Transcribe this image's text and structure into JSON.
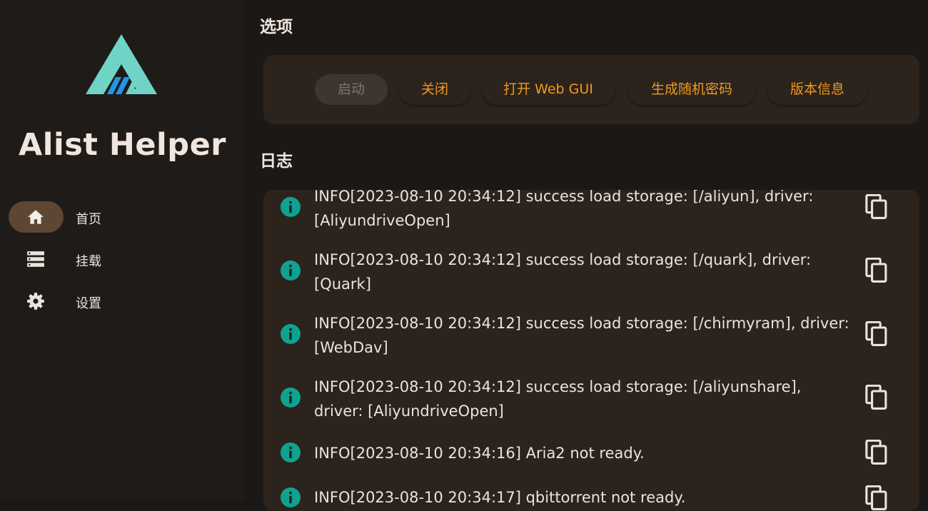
{
  "app": {
    "title": "Alist Helper"
  },
  "sidebar": {
    "items": [
      {
        "label": "首页",
        "icon": "home-icon",
        "active": true
      },
      {
        "label": "挂载",
        "icon": "storage-icon",
        "active": false
      },
      {
        "label": "设置",
        "icon": "gear-icon",
        "active": false
      }
    ]
  },
  "options": {
    "title": "选项",
    "buttons": [
      {
        "label": "启动",
        "enabled": false
      },
      {
        "label": "关闭",
        "enabled": true
      },
      {
        "label": "打开 Web GUI",
        "enabled": true
      },
      {
        "label": "生成随机密码",
        "enabled": true
      },
      {
        "label": "版本信息",
        "enabled": true
      }
    ]
  },
  "logs": {
    "title": "日志",
    "entries": [
      {
        "line1": "INFO[2023-08-10 20:34:12] success load storage: [/aliyun], driver:",
        "line2": "[AliyundriveOpen]"
      },
      {
        "line1": "INFO[2023-08-10 20:34:12] success load storage: [/quark], driver:",
        "line2": "[Quark]"
      },
      {
        "line1": "INFO[2023-08-10 20:34:12] success load storage: [/chirmyram], driver:",
        "line2": "[WebDav]"
      },
      {
        "line1": "INFO[2023-08-10 20:34:12] success load storage: [/aliyunshare],",
        "line2": "driver: [AliyundriveOpen]"
      },
      {
        "line1": "INFO[2023-08-10 20:34:16] Aria2 not ready.",
        "line2": ""
      },
      {
        "line1": "INFO[2023-08-10 20:34:17] qbittorrent not ready.",
        "line2": ""
      }
    ]
  },
  "colors": {
    "accent": "#f09a1f",
    "info": "#0ea391",
    "sidebar_bg": "#1f1b18",
    "card_bg": "#2c231c",
    "active_pill": "#5d4733"
  }
}
